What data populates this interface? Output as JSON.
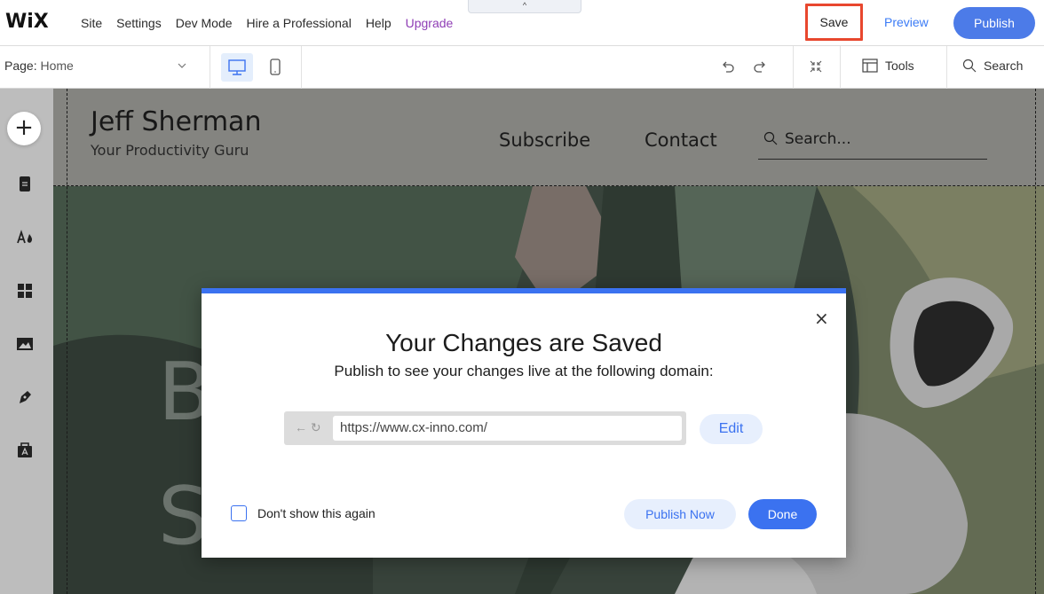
{
  "topbar": {
    "logo": "WiX",
    "menu": [
      "Site",
      "Settings",
      "Dev Mode",
      "Hire a Professional",
      "Help"
    ],
    "upgrade": "Upgrade",
    "collapse": "^",
    "save": "Save",
    "preview": "Preview",
    "publish": "Publish"
  },
  "subbar": {
    "page_label": "Page:",
    "page_value": "Home",
    "tools": "Tools",
    "search": "Search"
  },
  "site": {
    "name": "Jeff Sherman",
    "tagline": "Your Productivity Guru",
    "nav_subscribe": "Subscribe",
    "nav_contact": "Contact",
    "search_placeholder": "Search...",
    "hero_letter_1": "B",
    "hero_letter_2": "S"
  },
  "modal": {
    "title": "Your Changes are Saved",
    "subtitle": "Publish to see your changes live at the following domain:",
    "url": "https://www.cx-inno.com/",
    "edit": "Edit",
    "dont_show": "Don't show this again",
    "publish_now": "Publish Now",
    "done": "Done",
    "close": "×"
  },
  "colors": {
    "accent": "#3b72f0",
    "highlight": "#e8472e",
    "upgrade": "#8f3db5"
  }
}
